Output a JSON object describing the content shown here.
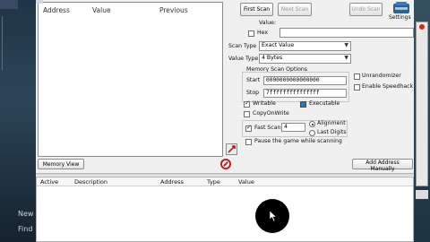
{
  "background": {
    "left_texts": [
      "New",
      "Find"
    ]
  },
  "address_list_headers": [
    "Address",
    "Value",
    "Previous"
  ],
  "scan": {
    "first_scan": "First Scan",
    "next_scan": "Next Scan",
    "undo_scan": "Undo Scan",
    "settings": "Settings",
    "value_label": "Value:",
    "hex_label": "Hex",
    "scan_type_label": "Scan Type",
    "scan_type_value": "Exact Value",
    "value_type_label": "Value Type",
    "value_type_value": "4 Bytes",
    "memory_options_label": "Memory Scan Options",
    "start_label": "Start",
    "start_value": "0000000000000000",
    "stop_label": "Stop",
    "stop_value": "7fffffffffffffff",
    "writable_label": "Writable",
    "writable_checked": true,
    "executable_label": "Executable",
    "executable_checked": false,
    "copyonwrite_label": "CopyOnWrite",
    "copyonwrite_checked": false,
    "fastscan_label": "Fast Scan",
    "fastscan_checked": true,
    "fastscan_value": "4",
    "alignment_label": "Alignment",
    "lastdigits_label": "Last Digits",
    "unrandomizer_label": "Unrandomizer",
    "speedhack_label": "Enable Speedhack",
    "pause_label": "Pause the game while scanning"
  },
  "bottom": {
    "memory_view": "Memory View",
    "add_address": "Add Address Manually",
    "columns": [
      "Active",
      "Description",
      "Address",
      "Type",
      "Value"
    ]
  },
  "colors": {
    "window_bg": "#f0f0f0",
    "desktop_bg": "#1a2a38",
    "stop_icon": "#cc1b1b"
  }
}
